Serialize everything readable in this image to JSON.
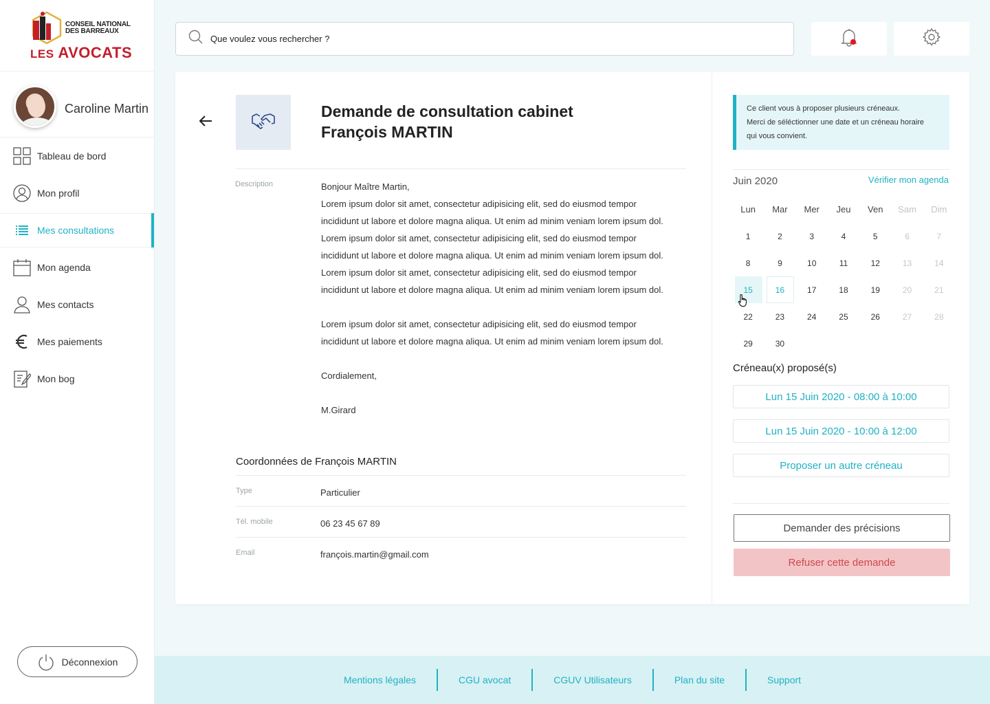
{
  "brand": {
    "logo_line1": "CONSEIL NATIONAL",
    "logo_line2": "DES BARREAUX",
    "logo_les": "LES",
    "logo_main": "AVOCATS"
  },
  "user": {
    "name": "Caroline Martin"
  },
  "nav": [
    {
      "label": "Tableau de bord",
      "icon": "dashboard-icon"
    },
    {
      "label": "Mon profil",
      "icon": "profile-icon"
    },
    {
      "label": "Mes consultations",
      "icon": "list-icon",
      "active": true
    },
    {
      "label": "Mon agenda",
      "icon": "calendar-icon"
    },
    {
      "label": "Mes contacts",
      "icon": "contacts-icon"
    },
    {
      "label": "Mes paiements",
      "icon": "euro-icon"
    },
    {
      "label": "Mon bog",
      "icon": "blog-icon"
    }
  ],
  "logout_label": "Déconnexion",
  "search": {
    "placeholder": "Que voulez vous rechercher ?"
  },
  "request": {
    "title_line1": "Demande de consultation cabinet",
    "title_line2": "François MARTIN",
    "description_label": "Description",
    "description": [
      "Bonjour Maître Martin,",
      "Lorem ipsum dolor sit amet, consectetur adipisicing elit, sed do eiusmod tempor",
      "incididunt ut labore et dolore magna aliqua. Ut enim ad minim veniam lorem ipsum dol.",
      "Lorem ipsum dolor sit amet, consectetur adipisicing elit, sed do eiusmod tempor",
      "incididunt ut labore et dolore magna aliqua. Ut enim ad minim veniam lorem ipsum dol.",
      "Lorem ipsum dolor sit amet, consectetur adipisicing elit, sed do eiusmod tempor",
      "incididunt ut labore et dolore magna aliqua. Ut enim ad minim veniam lorem ipsum dol.",
      "",
      "Lorem ipsum dolor sit amet, consectetur adipisicing elit, sed do eiusmod tempor",
      "incididunt ut labore et dolore magna aliqua. Ut enim ad minim veniam lorem ipsum dol.",
      "",
      "Cordialement,",
      "",
      "M.Girard"
    ]
  },
  "contact": {
    "title": "Coordonnées de François MARTIN",
    "rows": [
      {
        "label": "Type",
        "value": "Particulier"
      },
      {
        "label": "Tél. mobile",
        "value": "06 23 45 67 89"
      },
      {
        "label": "Email",
        "value": "françois.martin@gmail.com"
      }
    ]
  },
  "info": {
    "line1": "Ce client vous à proposer plusieurs créneaux.",
    "line2": "Merci de séléctionner une date et un créneau horaire",
    "line3": "qui vous convient."
  },
  "calendar": {
    "month": "Juin 2020",
    "link": "Vérifier mon agenda",
    "weekdays": [
      "Lun",
      "Mar",
      "Mer",
      "Jeu",
      "Ven",
      "Sam",
      "Dim"
    ],
    "weeks": [
      [
        "1",
        "2",
        "3",
        "4",
        "5",
        "6",
        "7"
      ],
      [
        "8",
        "9",
        "10",
        "11",
        "12",
        "13",
        "14"
      ],
      [
        "15",
        "16",
        "17",
        "18",
        "19",
        "20",
        "21"
      ],
      [
        "22",
        "23",
        "24",
        "25",
        "26",
        "27",
        "28"
      ],
      [
        "29",
        "30",
        "",
        "",
        "",
        "",
        ""
      ]
    ],
    "selected": [
      "15",
      "16"
    ]
  },
  "slots": {
    "title": "Créneau(x) proposé(s)",
    "items": [
      "Lun 15 Juin 2020 - 08:00 à 10:00",
      "Lun 15 Juin 2020 - 10:00 à 12:00",
      "Proposer un autre créneau"
    ]
  },
  "actions": {
    "ask_details": "Demander des précisions",
    "refuse": "Refuser cette demande"
  },
  "footer": [
    "Mentions légales",
    "CGU avocat",
    "CGUV Utilisateurs",
    "Plan du site",
    "Support"
  ],
  "colors": {
    "accent": "#1fb2c4",
    "danger_bg": "#f3c4c6",
    "danger_text": "#d0474f",
    "brand_red": "#c21f2b",
    "notification_dot": "#e8141b"
  }
}
